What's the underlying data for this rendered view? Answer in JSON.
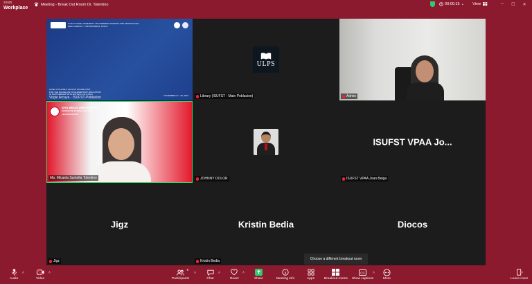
{
  "app": {
    "brand_top": "zoom",
    "brand_name": "Workplace"
  },
  "meeting": {
    "title": "Meeting - Break Out Room Dr. Tolentino"
  },
  "status": {
    "timer": "00:00:15",
    "view_label": "View"
  },
  "tiles": [
    {
      "name": "Virgie  Arcaya -  ISUFST-Poblacion",
      "kind": "slide",
      "slide": {
        "univ": "ILOILO STATE UNIVERSITY OF FISHERIES SCIENCE AND TECHNOLOGY",
        "campus": "MAIN CAMPUS - TIWI BUSINESS, ILOILO",
        "l1": "LEVEL III PHASE 2 AACCUP ONLINE VISIT",
        "l2": "FOR THE BACHELOR OF ELEMENTARY EDUCATION",
        "l3": "IN PARTNERSHIP WITH BIOTECH OF ILOILO",
        "date": "NOVEMBER 27 - 29, 2024"
      }
    },
    {
      "name": "Library (ISUFST - Main Poblacion)",
      "kind": "logo",
      "logo_text": "ULPS"
    },
    {
      "name": "Admin",
      "kind": "video-office"
    },
    {
      "name": "Ma. Micaela Santella Tolentino",
      "kind": "video-red",
      "banner": {
        "title": "SAN BEDA UNIVERSITY",
        "sub": "GRADUATE SCHOOL OF LAW",
        "sub2": "LEX MUNDUS ET"
      }
    },
    {
      "name": "JOHNNY DOLOR",
      "kind": "avatar"
    },
    {
      "name": "ISUFST VPAA Joan Belga",
      "kind": "text",
      "big": "ISUFST VPAA  Jo..."
    },
    {
      "name": "Jigz",
      "kind": "text",
      "big": "Jigz"
    },
    {
      "name": "Kristin Bedia",
      "kind": "text",
      "big": "Kristin Bedia"
    },
    {
      "name": "",
      "kind": "text",
      "big": "Diocos"
    }
  ],
  "tooltip": "Choose a different breakout room",
  "toolbar": {
    "audio": "Audio",
    "video": "Video",
    "participants": "Participants",
    "participants_count": "9",
    "chat": "Chat",
    "react": "React",
    "share": "Share",
    "meeting_info": "Meeting info",
    "apps": "Apps",
    "breakout": "Breakout rooms",
    "captions": "Show captions",
    "more": "More",
    "leave": "Leave room"
  },
  "colors": {
    "chrome": "#8c1a2e",
    "tile_bg": "#1c1c1c",
    "active_border": "#3fd36a",
    "share_green": "#2ecc71"
  }
}
